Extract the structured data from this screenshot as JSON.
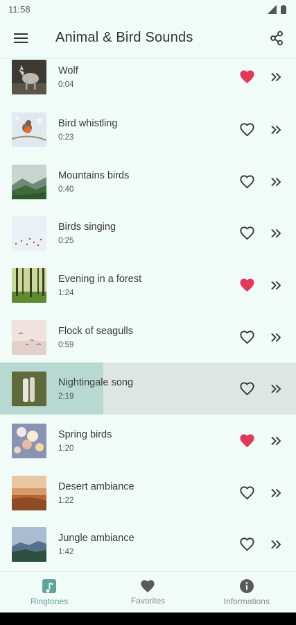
{
  "status": {
    "time": "11:58"
  },
  "app": {
    "title": "Animal & Bird Sounds"
  },
  "colors": {
    "accent": "#5fa597",
    "heart_filled": "#e0395a",
    "background": "#f1fbf8"
  },
  "sounds": [
    {
      "title": "Wolf",
      "duration": "0:04",
      "favorite": true,
      "thumb": "wolf"
    },
    {
      "title": "Bird whistling",
      "duration": "0:23",
      "favorite": false,
      "thumb": "robin"
    },
    {
      "title": "Mountains birds",
      "duration": "0:40",
      "favorite": false,
      "thumb": "mountains"
    },
    {
      "title": "Birds singing",
      "duration": "0:25",
      "favorite": false,
      "thumb": "flock-sky"
    },
    {
      "title": "Evening in a forest",
      "duration": "1:24",
      "favorite": true,
      "thumb": "forest"
    },
    {
      "title": "Flock of seagulls",
      "duration": "0:59",
      "favorite": false,
      "thumb": "seagulls"
    },
    {
      "title": "Nightingale song",
      "duration": "2:19",
      "favorite": false,
      "thumb": "nightingale",
      "playing": true,
      "progress": 0.35
    },
    {
      "title": "Spring birds",
      "duration": "1:20",
      "favorite": true,
      "thumb": "blossom"
    },
    {
      "title": "Desert ambiance",
      "duration": "1:22",
      "favorite": false,
      "thumb": "desert"
    },
    {
      "title": "Jungle ambiance",
      "duration": "1:42",
      "favorite": false,
      "thumb": "jungle"
    }
  ],
  "nav": [
    {
      "label": "Ringtones",
      "icon": "ringtone-icon",
      "selected": true
    },
    {
      "label": "Favorites",
      "icon": "heart-icon",
      "selected": false
    },
    {
      "label": "Informations",
      "icon": "info-icon",
      "selected": false
    }
  ]
}
